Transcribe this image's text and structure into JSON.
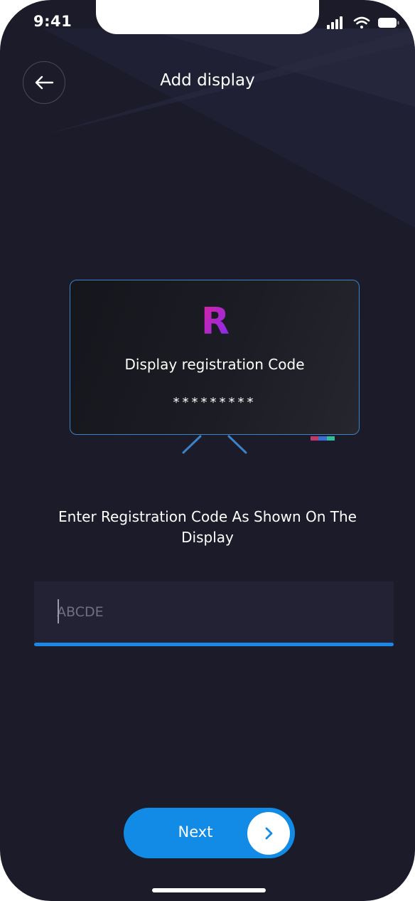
{
  "status_bar": {
    "time": "9:41",
    "icons": [
      "cellular-signal-icon",
      "wifi-icon",
      "battery-icon"
    ]
  },
  "header": {
    "back_icon": "arrow-left-icon",
    "title": "Add display"
  },
  "display_card": {
    "logo_letter": "R",
    "label": "Display registration Code",
    "masked_code": "*********"
  },
  "instruction": "Enter Registration Code As Shown On The Display",
  "code_input": {
    "value": "",
    "placeholder": "ABCDE"
  },
  "next_button": {
    "label": "Next",
    "icon": "chevron-right-icon"
  },
  "colors": {
    "background": "#1b1b2a",
    "accent": "#118be6",
    "tv_border": "#3c82c4",
    "logo_gradient": [
      "#e0219a",
      "#7b2ff7"
    ]
  }
}
